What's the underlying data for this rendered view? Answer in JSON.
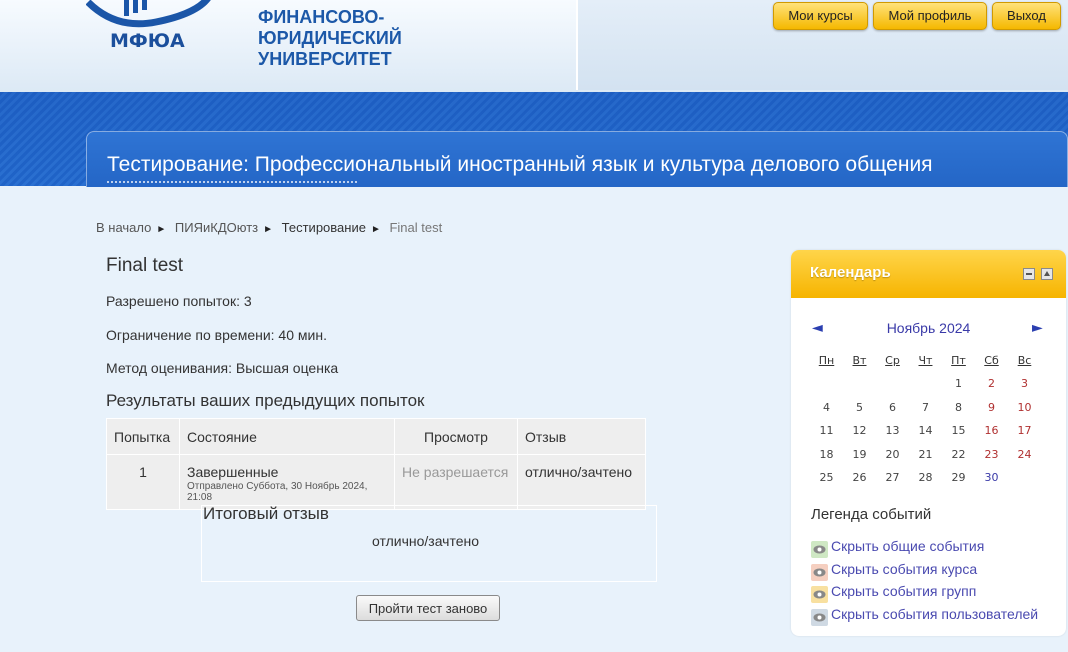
{
  "header": {
    "logo_text": "МФЮА",
    "university_name": [
      "ФИНАНСОВО-",
      "ЮРИДИЧЕСКИЙ",
      "УНИВЕРСИТЕТ"
    ],
    "nav_buttons": [
      "Мои курсы",
      "Мой профиль",
      "Выход"
    ]
  },
  "page_title": "Тестирование: Профессиональный иностранный язык и культура делового общения",
  "breadcrumb": [
    "В начало",
    "ПИЯиКДОютз",
    "Тестирование",
    "Final test"
  ],
  "quiz": {
    "title": "Final test",
    "attempts_allowed": "Разрешено попыток: 3",
    "time_limit": "Ограничение по времени: 40 мин.",
    "grading_method": "Метод оценивания: Высшая оценка",
    "results_heading": "Результаты ваших предыдущих попыток",
    "table": {
      "headers": [
        "Попытка",
        "Состояние",
        "Просмотр",
        "Отзыв"
      ],
      "rows": [
        {
          "attempt": "1",
          "state": "Завершенные",
          "submitted": "Отправлено Суббота, 30 Ноябрь 2024, 21:08",
          "review": "Не разрешается",
          "feedback": "отлично/зачтено"
        }
      ]
    },
    "final_feedback_heading": "Итоговый отзыв",
    "final_feedback_text": "отлично/зачтено",
    "retry_button": "Пройти тест заново"
  },
  "calendar": {
    "title": "Календарь",
    "prev_icon": "◄",
    "next_icon": "►",
    "month": "Ноябрь 2024",
    "weekdays": [
      "Пн",
      "Вт",
      "Ср",
      "Чт",
      "Пт",
      "Сб",
      "Вс"
    ],
    "weeks": [
      [
        "",
        "",
        "",
        "",
        "1",
        "2",
        "3"
      ],
      [
        "4",
        "5",
        "6",
        "7",
        "8",
        "9",
        "10"
      ],
      [
        "11",
        "12",
        "13",
        "14",
        "15",
        "16",
        "17"
      ],
      [
        "18",
        "19",
        "20",
        "21",
        "22",
        "23",
        "24"
      ],
      [
        "25",
        "26",
        "27",
        "28",
        "29",
        "30",
        ""
      ]
    ],
    "legend_title": "Легенда событий",
    "legend": [
      {
        "label": "Скрыть общие события",
        "color": "#cfe8c4"
      },
      {
        "label": "Скрыть события курса",
        "color": "#f5cfc0"
      },
      {
        "label": "Скрыть события групп",
        "color": "#f8e0a0"
      },
      {
        "label": "Скрыть события пользователей",
        "color": "#cfd9e3"
      }
    ]
  }
}
